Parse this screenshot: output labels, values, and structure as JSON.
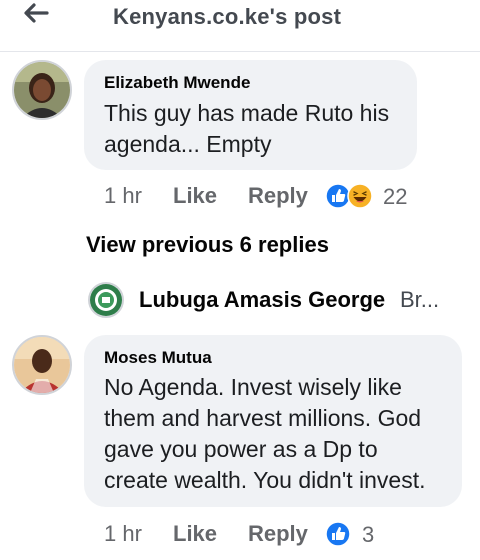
{
  "header": {
    "title": "Kenyans.co.ke's post"
  },
  "comments": [
    {
      "author": "Elizabeth Mwende",
      "text_lines": [
        "This guy has made Ruto his",
        "agenda... Empty"
      ],
      "time": "1 hr",
      "like_label": "Like",
      "reply_label": "Reply",
      "reaction_count": "22",
      "reactions": [
        "like-reaction-icon",
        "haha-reaction-icon"
      ]
    },
    {
      "author": "Moses Mutua",
      "text_lines": [
        "No Agenda. Invest wisely like",
        "them and harvest millions. God",
        "gave you power as a Dp to",
        "create wealth. You didn't invest."
      ],
      "time": "1 hr",
      "like_label": "Like",
      "reply_label": "Reply",
      "reaction_count": "3",
      "reactions": [
        "like-reaction-icon"
      ]
    }
  ],
  "view_previous": "View previous 6 replies",
  "reply_preview": {
    "author": "Lubuga Amasis George",
    "snippet": "Br..."
  },
  "colors": {
    "like_blue": "#1877f2",
    "haha_yellow": "#f7b125",
    "bubble": "#f0f2f5",
    "meta_grey": "#65676b"
  }
}
